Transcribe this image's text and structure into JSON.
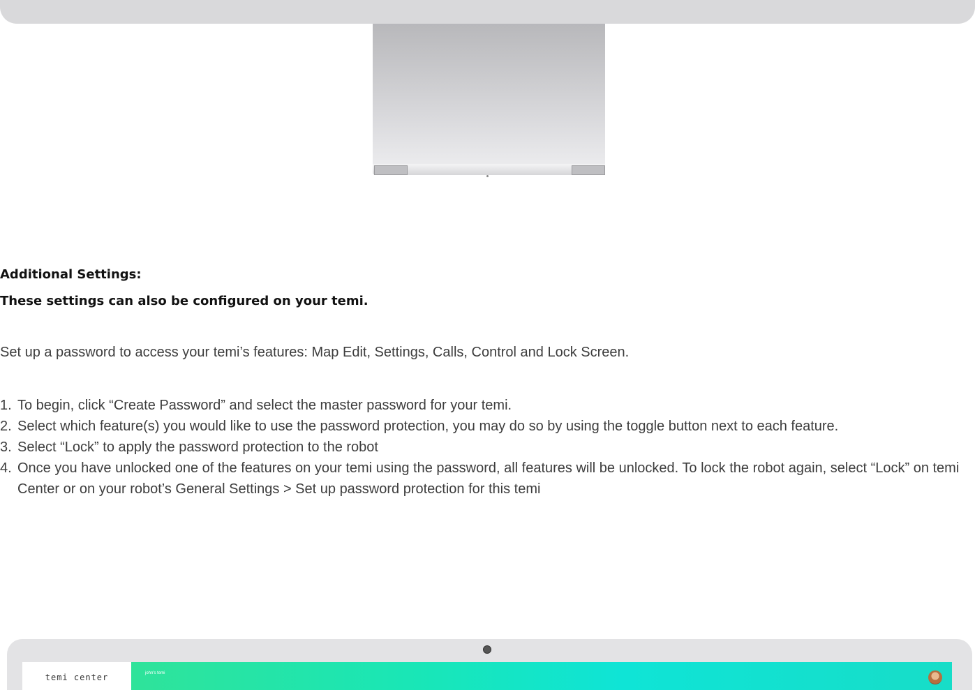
{
  "additional_settings": {
    "heading": "Additional Settings:",
    "subheading": "These settings can also be configured on your temi.",
    "intro": "Set up a password to access your temi’s features: Map Edit, Settings, Calls, Control and Lock Screen.",
    "steps": [
      {
        "number": "1.",
        "text": "To begin, click “Create Password” and select the master password for your temi."
      },
      {
        "number": "2.",
        "text": "Select which feature(s) you would like to use the password protection, you may do so by using the toggle button next to each feature."
      },
      {
        "number": "3.",
        "text": "Select “Lock” to apply the password protection to the robot"
      },
      {
        "number": "4.",
        "text": "Once you have unlocked one of the features on your temi using the password, all features will be unlocked. To lock the robot again, select “Lock” on temi Center or on your robot’s General Settings > Set up password protection for this temi"
      }
    ]
  },
  "temi_center": {
    "logo_text": "temi center",
    "robot_name": "john's temi",
    "avatar_icon": "user-avatar",
    "bar_colors": [
      "#2fe39a",
      "#0fe4d6"
    ]
  }
}
